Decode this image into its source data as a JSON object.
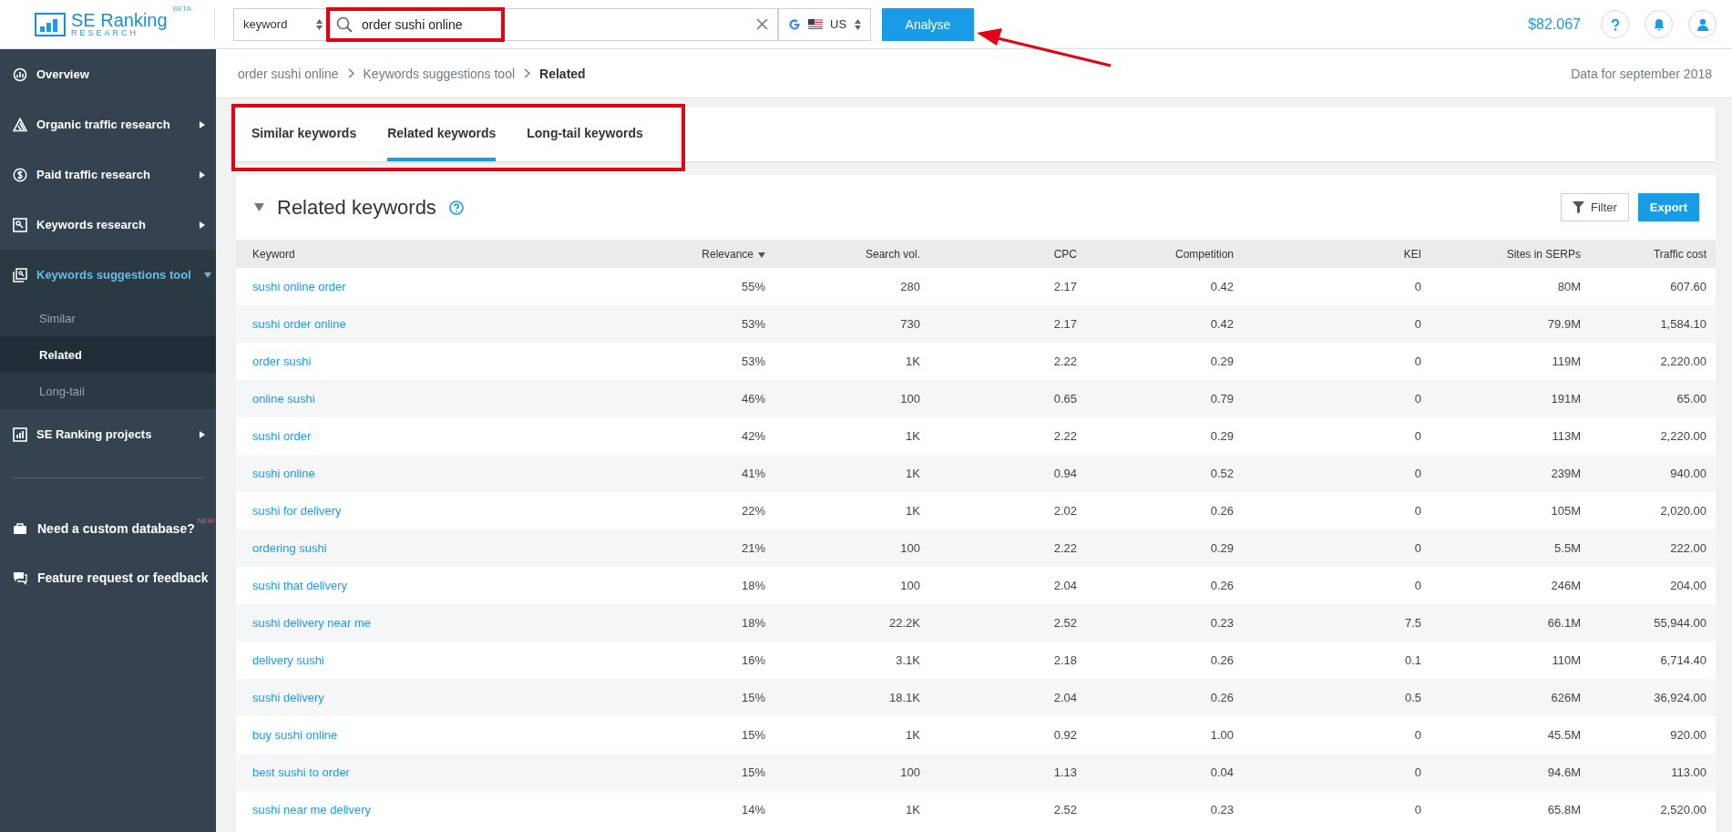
{
  "header": {
    "logo": {
      "name": "SE Ranking",
      "sub": "RESEARCH",
      "badge": "BETA"
    },
    "search_type": "keyword",
    "search": {
      "value": "order sushi online",
      "highlighted": true
    },
    "engine": {
      "country": "US"
    },
    "analyse_button": "Analyse",
    "annotation_arrow": true,
    "balance": "$82.067"
  },
  "sidebar": {
    "items": [
      {
        "label": "Overview",
        "expandable": false,
        "expanded": false,
        "selected": false
      },
      {
        "label": "Organic traffic research",
        "expandable": true,
        "expanded": false,
        "selected": false
      },
      {
        "label": "Paid traffic research",
        "expandable": true,
        "expanded": false,
        "selected": false
      },
      {
        "label": "Keywords research",
        "expandable": true,
        "expanded": false,
        "selected": false
      },
      {
        "label": "Keywords suggestions tool",
        "expandable": true,
        "expanded": true,
        "selected": true,
        "children": [
          {
            "label": "Similar",
            "selected": false
          },
          {
            "label": "Related",
            "selected": true
          },
          {
            "label": "Long-tail",
            "selected": false
          }
        ]
      },
      {
        "label": "SE Ranking projects",
        "expandable": true,
        "expanded": false,
        "selected": false
      }
    ],
    "extras": [
      {
        "label": "Need a custom database?",
        "badge": "NEW"
      },
      {
        "label": "Feature request or feedback"
      }
    ]
  },
  "breadcrumb": [
    "order sushi online",
    "Keywords suggestions tool",
    "Related"
  ],
  "data_date": "Data for september 2018",
  "tabs": {
    "highlighted": true,
    "items": [
      {
        "label": "Similar keywords",
        "selected": false
      },
      {
        "label": "Related keywords",
        "selected": true
      },
      {
        "label": "Long-tail keywords",
        "selected": false
      }
    ]
  },
  "section": {
    "title": "Related keywords",
    "buttons": [
      "Filter",
      "Export"
    ]
  },
  "table": {
    "columns": [
      {
        "label": "Keyword",
        "sorted": false
      },
      {
        "label": "Relevance",
        "sorted": true
      },
      {
        "label": "Search vol.",
        "sorted": false
      },
      {
        "label": "CPC",
        "sorted": false
      },
      {
        "label": "Competition",
        "sorted": false
      },
      {
        "label": "KEI",
        "sorted": false
      },
      {
        "label": "Sites in SERPs",
        "sorted": false
      },
      {
        "label": "Traffic cost",
        "sorted": false
      }
    ],
    "rows": [
      [
        "sushi online order",
        "55%",
        "280",
        "2.17",
        "0.42",
        "0",
        "80M",
        "607.60"
      ],
      [
        "sushi order online",
        "53%",
        "730",
        "2.17",
        "0.42",
        "0",
        "79.9M",
        "1,584.10"
      ],
      [
        "order sushi",
        "53%",
        "1K",
        "2.22",
        "0.29",
        "0",
        "119M",
        "2,220.00"
      ],
      [
        "online sushi",
        "46%",
        "100",
        "0.65",
        "0.79",
        "0",
        "191M",
        "65.00"
      ],
      [
        "sushi order",
        "42%",
        "1K",
        "2.22",
        "0.29",
        "0",
        "113M",
        "2,220.00"
      ],
      [
        "sushi online",
        "41%",
        "1K",
        "0.94",
        "0.52",
        "0",
        "239M",
        "940.00"
      ],
      [
        "sushi for delivery",
        "22%",
        "1K",
        "2.02",
        "0.26",
        "0",
        "105M",
        "2,020.00"
      ],
      [
        "ordering sushi",
        "21%",
        "100",
        "2.22",
        "0.29",
        "0",
        "5.5M",
        "222.00"
      ],
      [
        "sushi that delivery",
        "18%",
        "100",
        "2.04",
        "0.26",
        "0",
        "246M",
        "204.00"
      ],
      [
        "sushi delivery near me",
        "18%",
        "22.2K",
        "2.52",
        "0.23",
        "7.5",
        "66.1M",
        "55,944.00"
      ],
      [
        "delivery sushi",
        "16%",
        "3.1K",
        "2.18",
        "0.26",
        "0.1",
        "110M",
        "6,714.40"
      ],
      [
        "sushi delivery",
        "15%",
        "18.1K",
        "2.04",
        "0.26",
        "0.5",
        "626M",
        "36,924.00"
      ],
      [
        "buy sushi online",
        "15%",
        "1K",
        "0.92",
        "1.00",
        "0",
        "45.5M",
        "920.00"
      ],
      [
        "best sushi to order",
        "15%",
        "100",
        "1.13",
        "0.04",
        "0",
        "94.6M",
        "113.00"
      ],
      [
        "sushi near me delivery",
        "14%",
        "1K",
        "2.52",
        "0.23",
        "0",
        "65.8M",
        "2,520.00"
      ]
    ]
  }
}
